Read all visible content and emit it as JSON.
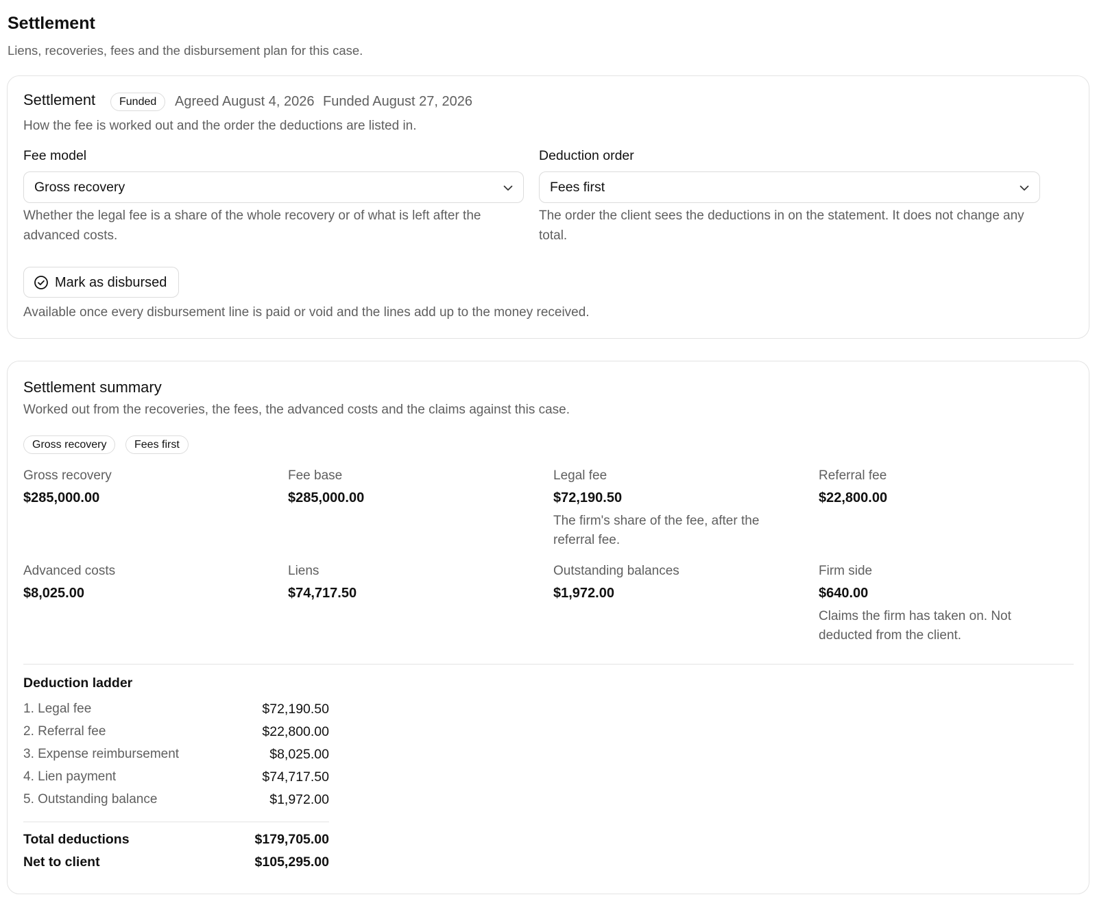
{
  "page": {
    "title": "Settlement",
    "subtitle": "Liens, recoveries, fees and the disbursement plan for this case."
  },
  "settlement": {
    "title": "Settlement",
    "status_badge": "Funded",
    "agreed": "Agreed August 4, 2026",
    "funded": "Funded August 27, 2026",
    "description": "How the fee is worked out and the order the deductions are listed in.",
    "fee_model": {
      "label": "Fee model",
      "value": "Gross recovery",
      "hint": "Whether the legal fee is a share of the whole recovery or of what is left after the advanced costs."
    },
    "deduction_order": {
      "label": "Deduction order",
      "value": "Fees first",
      "hint": "The order the client sees the deductions in on the statement. It does not change any total."
    },
    "mark_button": "Mark as disbursed",
    "availability": "Available once every disbursement line is paid or void and the lines add up to the money received."
  },
  "summary": {
    "title": "Settlement summary",
    "description": "Worked out from the recoveries, the fees, the advanced costs and the claims against this case.",
    "chips": [
      "Gross recovery",
      "Fees first"
    ],
    "metrics": [
      {
        "label": "Gross recovery",
        "value": "$285,000.00",
        "note": ""
      },
      {
        "label": "Fee base",
        "value": "$285,000.00",
        "note": ""
      },
      {
        "label": "Legal fee",
        "value": "$72,190.50",
        "note": "The firm's share of the fee, after the referral fee."
      },
      {
        "label": "Referral fee",
        "value": "$22,800.00",
        "note": ""
      },
      {
        "label": "Advanced costs",
        "value": "$8,025.00",
        "note": ""
      },
      {
        "label": "Liens",
        "value": "$74,717.50",
        "note": ""
      },
      {
        "label": "Outstanding balances",
        "value": "$1,972.00",
        "note": ""
      },
      {
        "label": "Firm side",
        "value": "$640.00",
        "note": "Claims the firm has taken on. Not deducted from the client."
      }
    ],
    "ladder": {
      "title": "Deduction ladder",
      "rows": [
        {
          "label": "1. Legal fee",
          "value": "$72,190.50"
        },
        {
          "label": "2. Referral fee",
          "value": "$22,800.00"
        },
        {
          "label": "3. Expense reimbursement",
          "value": "$8,025.00"
        },
        {
          "label": "4. Lien payment",
          "value": "$74,717.50"
        },
        {
          "label": "5. Outstanding balance",
          "value": "$1,972.00"
        }
      ],
      "total_label": "Total deductions",
      "total_value": "$179,705.00",
      "net_label": "Net to client",
      "net_value": "$105,295.00"
    }
  }
}
